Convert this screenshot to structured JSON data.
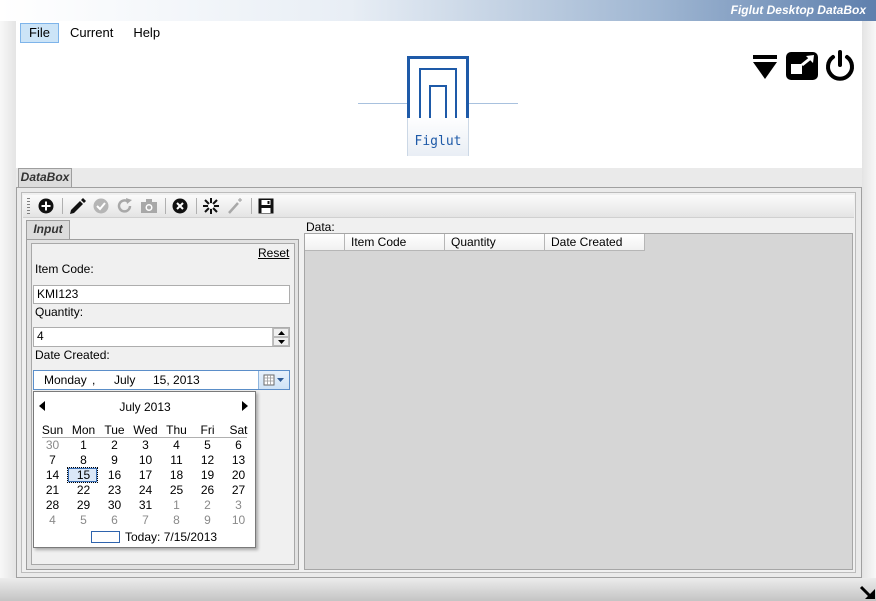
{
  "app": {
    "title": "Figlut Desktop DataBox"
  },
  "menu": {
    "items": [
      "File",
      "Current",
      "Help"
    ],
    "active": "File"
  },
  "logo": {
    "text": "Figlut"
  },
  "window_controls": {
    "icons": [
      "minimize-down-icon",
      "restore-icon",
      "power-icon"
    ]
  },
  "tabs": {
    "main": "DataBox",
    "input": "Input"
  },
  "toolbar": {
    "icons": [
      "add-icon",
      "edit-pencil-icon",
      "check-icon",
      "refresh-icon",
      "camera-icon",
      "cancel-icon",
      "burst-icon",
      "magic-wand-icon",
      "save-icon"
    ]
  },
  "input": {
    "reset_label": "Reset",
    "item_code_label": "Item Code:",
    "item_code_value": "KMI123",
    "quantity_label": "Quantity:",
    "quantity_value": "4",
    "date_label": "Date Created:",
    "date_value": {
      "weekday": "Monday",
      "sep": ",",
      "month": "July",
      "day": "15, 2013"
    }
  },
  "calendar": {
    "month_label": "July 2013",
    "weekdays": [
      "Sun",
      "Mon",
      "Tue",
      "Wed",
      "Thu",
      "Fri",
      "Sat"
    ],
    "weeks": [
      [
        "30",
        "1",
        "2",
        "3",
        "4",
        "5",
        "6"
      ],
      [
        "7",
        "8",
        "9",
        "10",
        "11",
        "12",
        "13"
      ],
      [
        "14",
        "15",
        "16",
        "17",
        "18",
        "19",
        "20"
      ],
      [
        "21",
        "22",
        "23",
        "24",
        "25",
        "26",
        "27"
      ],
      [
        "28",
        "29",
        "30",
        "31",
        "1",
        "2",
        "3"
      ],
      [
        "4",
        "5",
        "6",
        "7",
        "8",
        "9",
        "10"
      ]
    ],
    "selected": "15",
    "today_label": "Today: 7/15/2013"
  },
  "data_grid": {
    "label": "Data:",
    "columns": [
      "",
      "Item Code",
      "Quantity",
      "Date Created"
    ]
  },
  "colors": {
    "accent": "#1e5aa8",
    "menu_active": "#cce4f7"
  }
}
